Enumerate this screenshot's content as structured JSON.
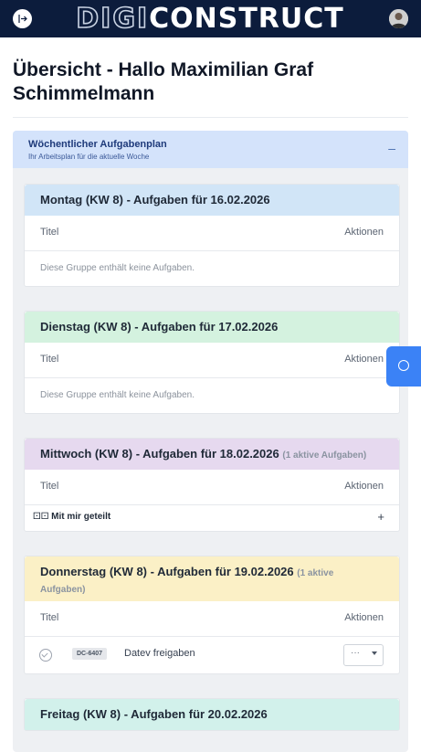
{
  "header": {
    "logo_part1": "DIGI",
    "logo_part2": "CONSTRUCT",
    "back_icon": "logout-icon",
    "avatar_icon": "user-avatar"
  },
  "page": {
    "title": "Übersicht - Hallo Maximilian Graf Schimmelmann"
  },
  "weekly": {
    "title": "Wöchentlicher Aufgabenplan",
    "subtitle": "Ihr Arbeitsplan für die aktuelle Woche",
    "collapse_label": "–",
    "colors": {
      "header": "#d4e3fb"
    }
  },
  "columns": {
    "title": "Titel",
    "actions": "Aktionen"
  },
  "days": [
    {
      "title": "Montag (KW 8) - Aufgaben für 16.02.2026",
      "count": "",
      "color": "#d1e5f7",
      "empty_text": "Diese Gruppe enthält keine Aufgaben."
    },
    {
      "title": "Dienstag (KW 8) - Aufgaben für 17.02.2026",
      "count": "",
      "color": "#d4f2df",
      "empty_text": "Diese Gruppe enthält keine Aufgaben."
    },
    {
      "title": "Mittwoch (KW 8) - Aufgaben für 18.02.2026",
      "count": "(1 aktive Aufgaben)",
      "color": "#e6d9ef",
      "shared_label": "Mit mir geteilt",
      "shared_icon": "binoculars-icon",
      "add_label": "+"
    },
    {
      "title": "Donnerstag (KW 8) - Aufgaben für 19.02.2026",
      "count": "(1 aktive Aufgaben)",
      "color": "#fbf0c6",
      "task": {
        "id": "DC-6407",
        "name": "Datev freigaben",
        "menu_label": "···"
      }
    },
    {
      "title": "Freitag (KW 8) - Aufgaben für 20.02.2026",
      "count": "",
      "color": "#d2f1eb"
    }
  ],
  "help_button": {
    "icon": "help-icon",
    "color": "#3b82f6"
  }
}
